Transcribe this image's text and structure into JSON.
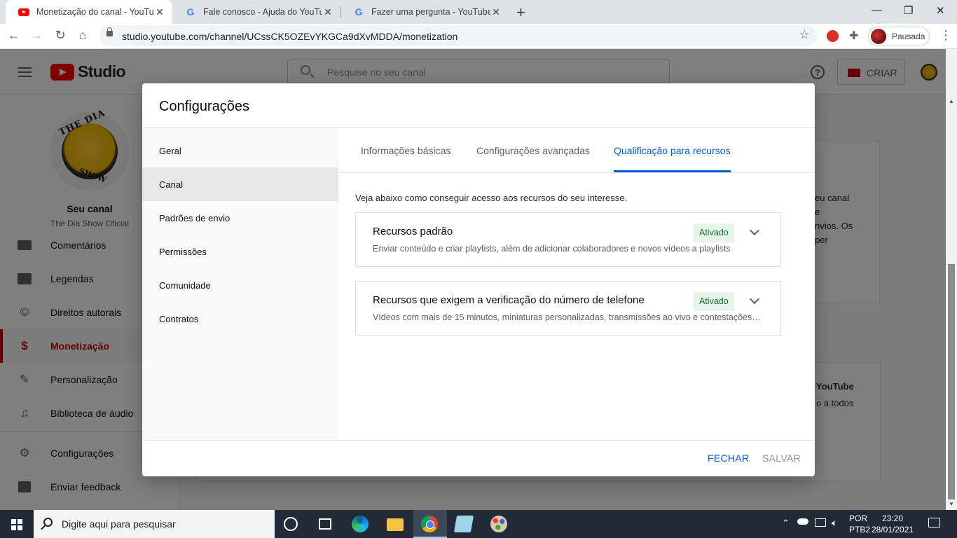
{
  "browser": {
    "tabs": [
      {
        "title": "Monetização do canal - YouTube",
        "favicon": "youtube-icon",
        "active": true
      },
      {
        "title": "Fale conosco - Ajuda do YouTube",
        "favicon": "google-icon",
        "active": false
      },
      {
        "title": "Fazer uma pergunta - YouTube Community",
        "favicon": "google-icon",
        "active": false
      }
    ],
    "url": "studio.youtube.com/channel/UCssCK5OZEvYKGCa9dXvMDDA/monetization",
    "profile_label": "Pausada"
  },
  "studio": {
    "logo_text": "Studio",
    "search_placeholder": "Pesquise no seu canal",
    "create_label": "CRIAR",
    "channel_name": "Seu canal",
    "channel_handle": "The Dia Show Oficial",
    "avatar_text_top": "THE DIA",
    "avatar_text_bottom": "SHOW",
    "nav": [
      {
        "label": "Comentários",
        "icon": "comments-icon"
      },
      {
        "label": "Legendas",
        "icon": "subtitles-icon"
      },
      {
        "label": "Direitos autorais",
        "icon": "copyright-icon"
      },
      {
        "label": "Monetização",
        "icon": "dollar-icon",
        "selected": true
      },
      {
        "label": "Personalização",
        "icon": "magic-wand-icon"
      },
      {
        "label": "Biblioteca de áudio",
        "icon": "audio-library-icon"
      }
    ],
    "nav_bottom": [
      {
        "label": "Configurações",
        "icon": "gear-icon"
      },
      {
        "label": "Enviar feedback",
        "icon": "feedback-icon"
      }
    ],
    "bg_fragments": {
      "card1_lines": [
        "eu canal",
        "e",
        "nvios. Os",
        "per"
      ],
      "card2_title": "YouTube",
      "card2_line": "o a todos"
    }
  },
  "dialog": {
    "title": "Configurações",
    "sidebar": [
      {
        "label": "Geral"
      },
      {
        "label": "Canal",
        "selected": true
      },
      {
        "label": "Padrões de envio"
      },
      {
        "label": "Permissões"
      },
      {
        "label": "Comunidade"
      },
      {
        "label": "Contratos"
      }
    ],
    "tabs": [
      {
        "label": "Informações básicas"
      },
      {
        "label": "Configurações avançadas"
      },
      {
        "label": "Qualificação para recursos",
        "selected": true
      }
    ],
    "intro": "Veja abaixo como conseguir acesso aos recursos do seu interesse.",
    "features": [
      {
        "title": "Recursos padrão",
        "description": "Enviar conteúdo e criar playlists, além de adicionar colaboradores e novos vídeos a playlists",
        "status": "Ativado"
      },
      {
        "title": "Recursos que exigem a verificação do número de telefone",
        "description": "Vídeos com mais de 15 minutos, miniaturas personalizadas, transmissões ao vivo e contestações de Content ID",
        "status": "Ativado"
      }
    ],
    "close_label": "FECHAR",
    "save_label": "SALVAR"
  },
  "taskbar": {
    "search_placeholder": "Digite aqui para pesquisar",
    "lang_top": "POR",
    "lang_bottom": "PTB2",
    "time": "23:20",
    "date": "28/01/2021"
  },
  "colors": {
    "accent_blue": "#065fd4",
    "youtube_red": "#ff0000",
    "selected_nav_red": "#cc0000",
    "badge_bg": "#e6f4ea",
    "badge_text": "#137333"
  }
}
